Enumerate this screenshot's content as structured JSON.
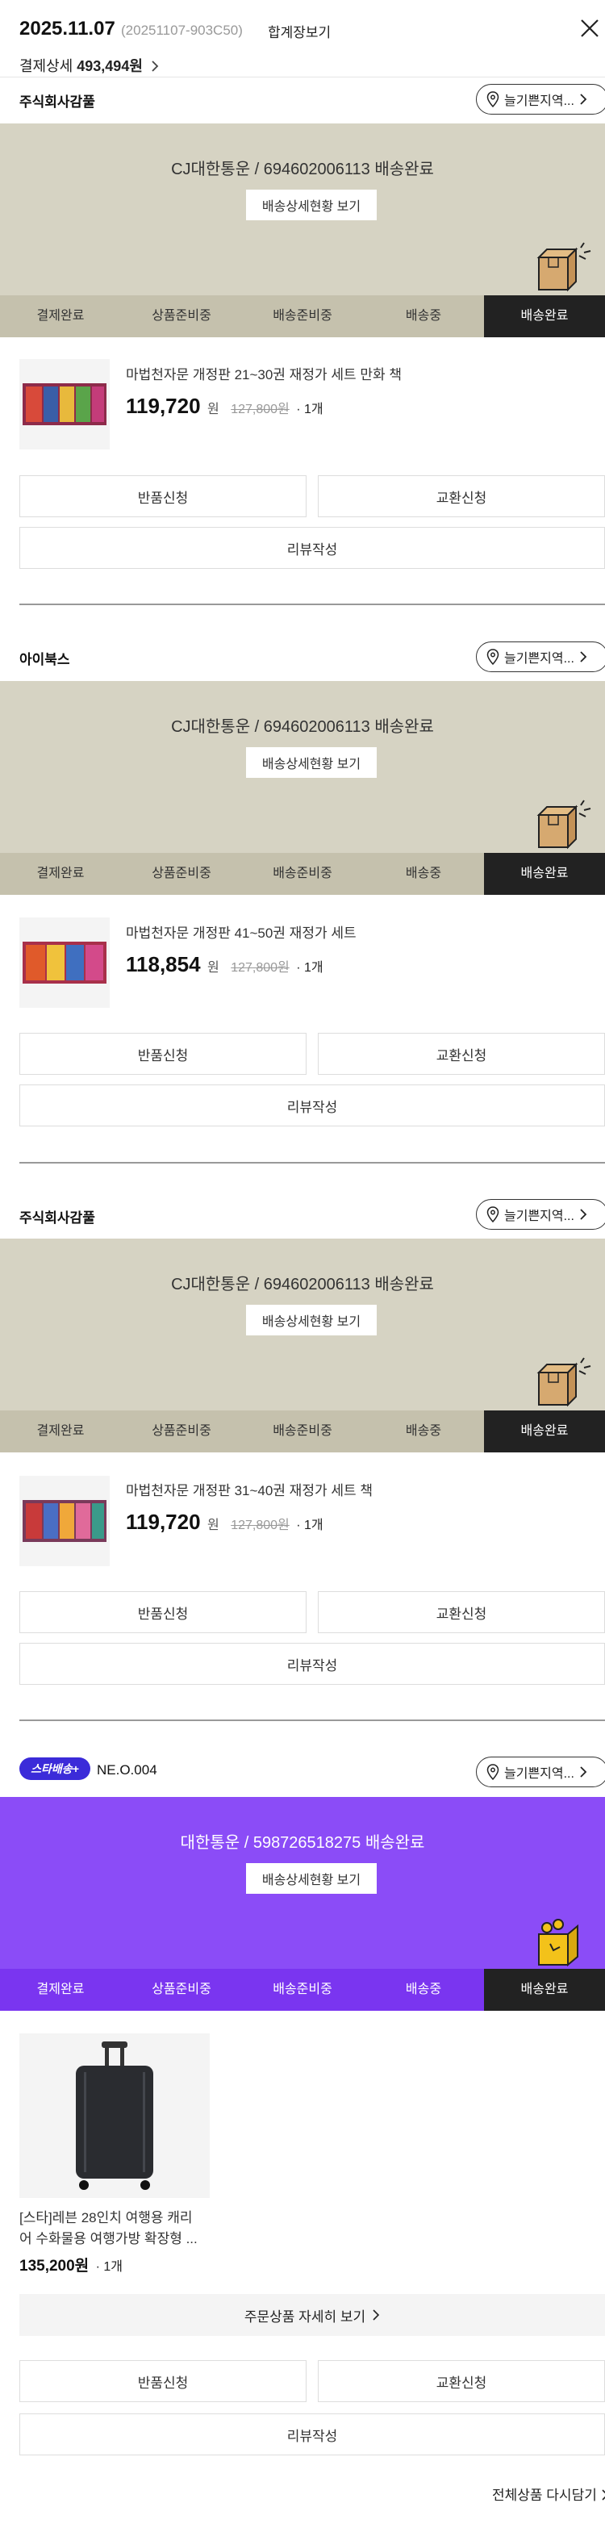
{
  "header": {
    "date": "2025.11.07",
    "order_code": "(20251107-903C50)",
    "receipt_link": "합계장보기",
    "payment_label": "결제상세",
    "payment_amount": "493,494원"
  },
  "track_button": "배송상세현황 보기",
  "steps": [
    "결제완료",
    "상품준비중",
    "배송준비중",
    "배송중",
    "배송완료"
  ],
  "location_button": "늘기쁜지역...",
  "actions": {
    "return": "반품신청",
    "exchange": "교환신청",
    "review": "리뷰작성"
  },
  "shipments": [
    {
      "seller": "주식회사감풀",
      "tracking": "CJ대한통운 / 694602006113 배송완료",
      "product": "마법천자문 개정판 21~30권 재정가 세트 만화 책",
      "price": "119,720",
      "won": "원",
      "original": "127,800원",
      "qty": "· 1개"
    },
    {
      "seller": "아이북스",
      "tracking": "CJ대한통운 / 694602006113 배송완료",
      "product": "마법천자문 개정판 41~50권 재정가 세트",
      "price": "118,854",
      "won": "원",
      "original": "127,800원",
      "qty": "· 1개"
    },
    {
      "seller": "주식회사감풀",
      "tracking": "CJ대한통운 / 694602006113 배송완료",
      "product": "마법천자문 개정판 31~40권 재정가 세트 책",
      "price": "119,720",
      "won": "원",
      "original": "127,800원",
      "qty": "· 1개"
    }
  ],
  "star_shipment": {
    "badge": "스타배송+",
    "seller": "NE.O.004",
    "tracking": "대한통운 / 598726518275 배송완료",
    "product_line1": "[스타]레븐 28인치 여행용 캐리",
    "product_line2": "어 수화물용 여행가방 확장형 ...",
    "price": "135,200원",
    "qty": "· 1개",
    "details_button": "주문상품 자세히 보기"
  },
  "reorder": "전체상품 다시담기",
  "colors": {
    "track_bg": "#d6d3c3",
    "steps_bg": "#c5c1ad",
    "star_bg": "#8b4cf7",
    "star_steps_bg": "#7a35f0",
    "active_step": "#222222",
    "badge": "#3b2bd9"
  }
}
